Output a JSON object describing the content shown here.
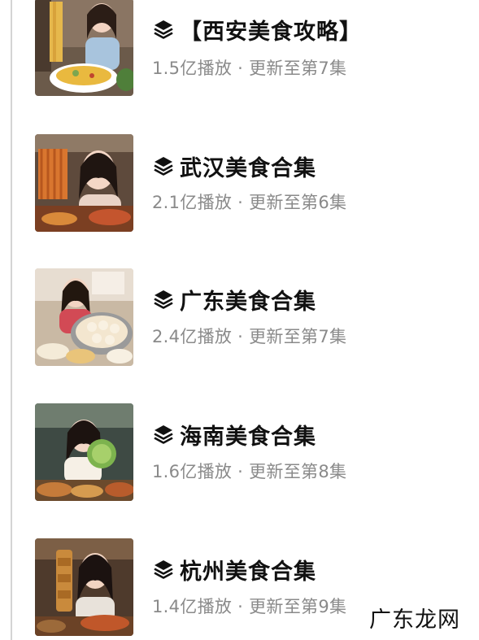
{
  "items": [
    {
      "title": "【西安美食攻略】",
      "meta": "1.5亿播放 · 更新至第7集",
      "icon": "stack-layers-icon"
    },
    {
      "title": "武汉美食合集",
      "meta": "2.1亿播放 · 更新至第6集",
      "icon": "stack-layers-icon"
    },
    {
      "title": "广东美食合集",
      "meta": "2.4亿播放 · 更新至第7集",
      "icon": "stack-layers-icon"
    },
    {
      "title": "海南美食合集",
      "meta": "1.6亿播放 · 更新至第8集",
      "icon": "stack-layers-icon"
    },
    {
      "title": "杭州美食合集",
      "meta": "1.4亿播放 · 更新至第9集",
      "icon": "stack-layers-icon"
    }
  ],
  "watermark": "广东龙网",
  "colors": {
    "title": "#111111",
    "meta": "#8a8a8a",
    "border": "#d4d4d4",
    "background": "#ffffff"
  }
}
